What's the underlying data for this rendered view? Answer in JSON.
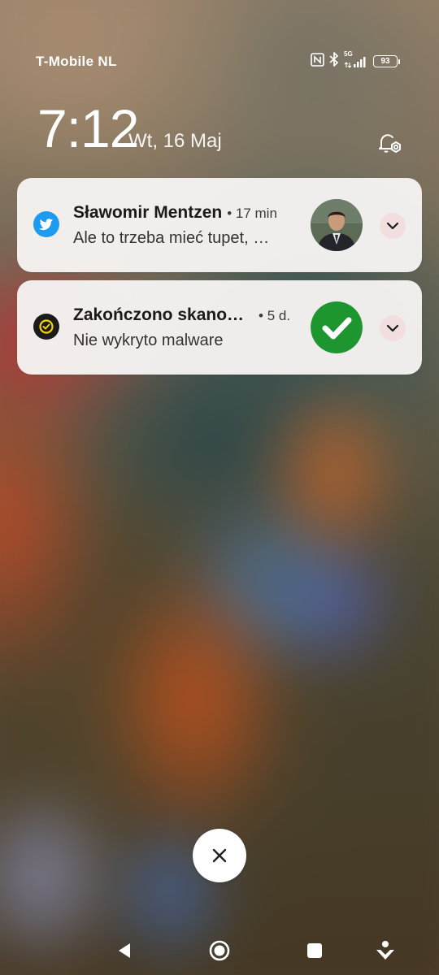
{
  "status_bar": {
    "carrier": "T-Mobile  NL",
    "network_type": "5G",
    "battery_level": "93",
    "icons": [
      "nfc-icon",
      "bluetooth-icon",
      "signal-icon",
      "battery-icon"
    ]
  },
  "lockscreen": {
    "time": "7:12",
    "date": "Wt, 16 Maj"
  },
  "notifications": [
    {
      "app_icon": "twitter-icon",
      "title": "Sławomir Mentzen",
      "time": "• 17 min",
      "body": "Ale to trzeba mieć tupet, …",
      "thumbnail": "profile-photo",
      "accent": "#1d9bf0"
    },
    {
      "app_icon": "security-scan-icon",
      "title": "Zakończono skano…",
      "time": "• 5 d.",
      "body": "Nie wykryto malware",
      "thumbnail": "checkmark-badge",
      "accent": "#1e9630"
    }
  ],
  "colors": {
    "card_background": "#f6f4f3",
    "expand_button": "#f2dede",
    "check_green": "#1e9630",
    "scan_yellow": "#f5d20a"
  }
}
